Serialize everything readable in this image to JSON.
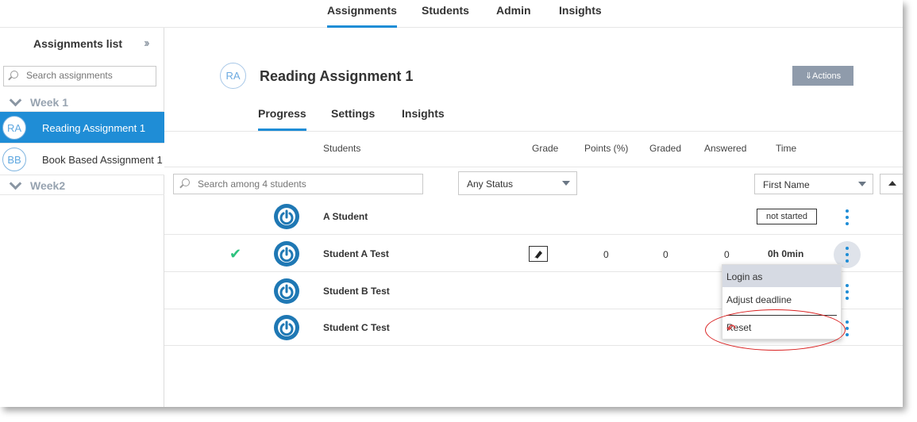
{
  "topnav": {
    "items": [
      {
        "label": "Assignments",
        "active": true
      },
      {
        "label": "Students"
      },
      {
        "label": "Admin"
      },
      {
        "label": "Insights"
      }
    ]
  },
  "sidebar": {
    "title": "Assignments list",
    "collapse_icon": "double-chevron-right-icon",
    "search_placeholder": "Search assignments",
    "groups": [
      {
        "label": "Week 1",
        "items": [
          {
            "initials": "RA",
            "label": "Reading Assignment 1",
            "active": true
          },
          {
            "initials": "BB",
            "label": "Book Based Assignment 1"
          }
        ]
      },
      {
        "label": "Week2",
        "items": []
      }
    ]
  },
  "assignment": {
    "initials": "RA",
    "title": "Reading Assignment 1",
    "actions_label": "⇓Actions",
    "tabs": [
      {
        "label": "Progress",
        "active": true
      },
      {
        "label": "Settings"
      },
      {
        "label": "Insights"
      }
    ]
  },
  "table": {
    "columns": [
      "Students",
      "Grade",
      "Points (%)",
      "Graded",
      "Answered",
      "Time"
    ],
    "search_placeholder": "Search among 4 students",
    "status_filter": "Any Status",
    "sort_by": "First Name",
    "rows": [
      {
        "name": "A Student",
        "status": "not started"
      },
      {
        "name": "Student A Test",
        "checked": true,
        "points": "0",
        "graded": "0",
        "answered": "0",
        "time": "0h 0min"
      },
      {
        "name": "Student B Test"
      },
      {
        "name": "Student C Test"
      }
    ]
  },
  "context_menu": {
    "items": [
      {
        "label": "Login as",
        "highlighted": true
      },
      {
        "label": "Adjust deadline"
      },
      {
        "label": "Reset",
        "icon": "undo-icon"
      }
    ]
  },
  "colors": {
    "accent": "#1f8dd6",
    "power_icon": "#1f78b4",
    "check": "#2ec27e",
    "annotation": "#d92020"
  }
}
